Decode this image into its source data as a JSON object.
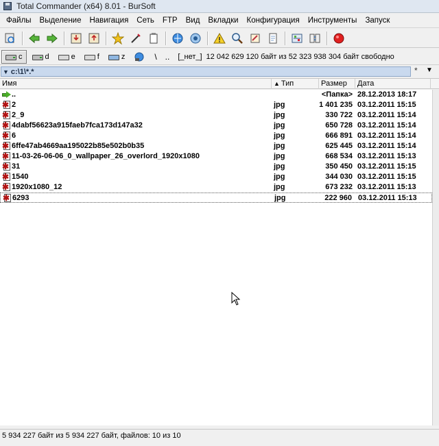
{
  "window": {
    "title": "Total Commander (x64) 8.01 - BurSoft"
  },
  "menu": [
    "Файлы",
    "Выделение",
    "Навигация",
    "Сеть",
    "FTP",
    "Вид",
    "Вкладки",
    "Конфигурация",
    "Инструменты",
    "Запуск"
  ],
  "toolbar": {
    "icons": [
      "refresh-icon",
      "back-icon",
      "forward-icon",
      "pack-icon",
      "unpack-icon",
      "favorites-icon",
      "multi-rename-icon",
      "notepad-icon",
      "browser-icon",
      "ftp-icon",
      "warning-icon",
      "search-icon",
      "rename-icon",
      "document-icon",
      "compare-icon",
      "sync-icon",
      "stop-icon"
    ]
  },
  "drives": {
    "items": [
      {
        "letter": "c",
        "active": true
      },
      {
        "letter": "d",
        "active": false
      },
      {
        "letter": "e",
        "active": false
      },
      {
        "letter": "f",
        "active": false
      },
      {
        "letter": "z",
        "active": false
      }
    ],
    "network_label": "\\",
    "root_label": "..",
    "label_none": "[_нет_]",
    "free_space": "12 042 629 120 байт из 52 323 938 304 байт свободно"
  },
  "path": {
    "value": "c:\\1\\*.*",
    "star": "*",
    "dropdown": "▼"
  },
  "columns": {
    "name": "Имя",
    "type": "Тип",
    "size": "Размер",
    "date": "Дата"
  },
  "files": [
    {
      "name": "..",
      "type": "",
      "size": "<Папка>",
      "date": "28.12.2013 18:17",
      "kind": "up"
    },
    {
      "name": "2",
      "type": "jpg",
      "size": "1 401 235",
      "date": "03.12.2011 15:15",
      "kind": "jpg"
    },
    {
      "name": "2_9",
      "type": "jpg",
      "size": "330 722",
      "date": "03.12.2011 15:14",
      "kind": "jpg"
    },
    {
      "name": "4dabf56623a915faeb7fca173d147a32",
      "type": "jpg",
      "size": "650 728",
      "date": "03.12.2011 15:14",
      "kind": "jpg"
    },
    {
      "name": "6",
      "type": "jpg",
      "size": "666 891",
      "date": "03.12.2011 15:14",
      "kind": "jpg"
    },
    {
      "name": "6ffe47ab4669aa195022b85e502b0b35",
      "type": "jpg",
      "size": "625 445",
      "date": "03.12.2011 15:14",
      "kind": "jpg"
    },
    {
      "name": "11-03-26-06-06_0_wallpaper_26_overlord_1920x1080",
      "type": "jpg",
      "size": "668 534",
      "date": "03.12.2011 15:13",
      "kind": "jpg"
    },
    {
      "name": "31",
      "type": "jpg",
      "size": "350 450",
      "date": "03.12.2011 15:15",
      "kind": "jpg"
    },
    {
      "name": "1540",
      "type": "jpg",
      "size": "344 030",
      "date": "03.12.2011 15:15",
      "kind": "jpg"
    },
    {
      "name": "1920x1080_12",
      "type": "jpg",
      "size": "673 232",
      "date": "03.12.2011 15:13",
      "kind": "jpg"
    },
    {
      "name": "6293",
      "type": "jpg",
      "size": "222 960",
      "date": "03.12.2011 15:13",
      "kind": "jpg",
      "focused": true
    }
  ],
  "status": "5 934 227 байт из 5 934 227 байт, файлов: 10 из 10"
}
